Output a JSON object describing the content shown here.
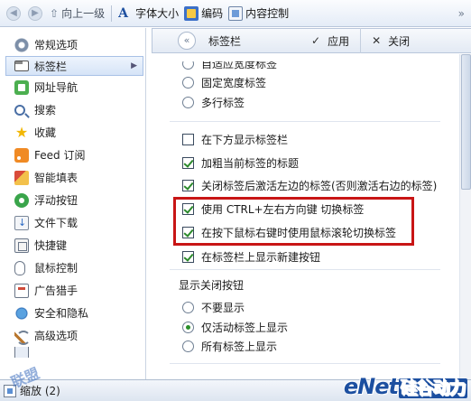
{
  "toolbar": {
    "up_label": "向上一级",
    "font_size_label": "字体大小",
    "encoding_label": "编码",
    "content_control_label": "内容控制"
  },
  "sidebar": {
    "items": [
      {
        "label": "常规选项",
        "icon": "general-settings-icon"
      },
      {
        "label": "标签栏",
        "icon": "tab-bar-icon",
        "selected": true
      },
      {
        "label": "网址导航",
        "icon": "url-nav-icon"
      },
      {
        "label": "搜索",
        "icon": "search-icon"
      },
      {
        "label": "收藏",
        "icon": "star-icon"
      },
      {
        "label": "Feed 订阅",
        "icon": "feed-icon"
      },
      {
        "label": "智能填表",
        "icon": "smart-fill-icon"
      },
      {
        "label": "浮动按钮",
        "icon": "floating-button-icon"
      },
      {
        "label": "文件下载",
        "icon": "download-icon"
      },
      {
        "label": "快捷键",
        "icon": "shortcut-key-icon"
      },
      {
        "label": "鼠标控制",
        "icon": "mouse-icon"
      },
      {
        "label": "广告猎手",
        "icon": "ad-hunter-icon"
      },
      {
        "label": "安全和隐私",
        "icon": "security-icon"
      },
      {
        "label": "高级选项",
        "icon": "advanced-icon"
      }
    ]
  },
  "panel": {
    "title": "标签栏",
    "apply_label": "应用",
    "close_label": "关闭"
  },
  "tab_width": {
    "options": [
      {
        "label": "自适应宽度标签",
        "checked": false
      },
      {
        "label": "固定宽度标签",
        "checked": false
      },
      {
        "label": "多行标签",
        "checked": false
      }
    ]
  },
  "tab_options": [
    {
      "label": "在下方显示标签栏",
      "checked": false
    },
    {
      "label": "加粗当前标签的标题",
      "checked": true
    },
    {
      "label": "关闭标签后激活左边的标签(否则激活右边的标签)",
      "checked": true
    },
    {
      "label": "使用 CTRL+左右方向键 切换标签",
      "checked": true
    },
    {
      "label": "在按下鼠标右键时使用鼠标滚轮切换标签",
      "checked": true
    },
    {
      "label": "在标签栏上显示新建按钮",
      "checked": true
    }
  ],
  "close_button": {
    "section_title": "显示关闭按钮",
    "options": [
      {
        "label": "不要显示",
        "checked": false
      },
      {
        "label": "仅活动标签上显示",
        "checked": true
      },
      {
        "label": "所有标签上显示",
        "checked": false
      }
    ]
  },
  "status": {
    "zoom_label": "缩放 (2)"
  },
  "watermark": {
    "brand": "eNet",
    "brand_cn": "硅谷动力",
    "overlay": "联盟"
  },
  "colors": {
    "highlight": "#c81515",
    "check": "#2c8a2c",
    "selected_bg": "#d6e4f7"
  }
}
